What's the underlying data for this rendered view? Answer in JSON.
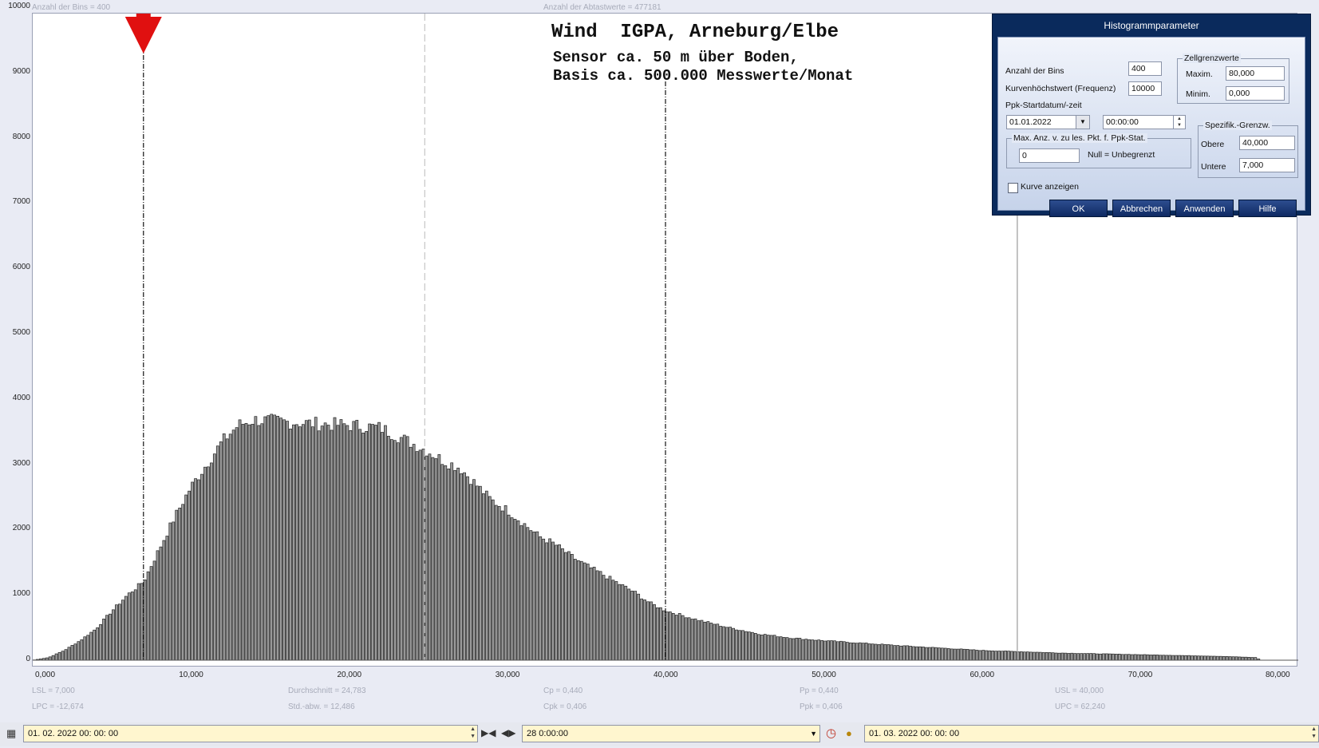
{
  "top_labels": {
    "bins": "Anzahl der Bins =   400",
    "samples": "Anzahl der Abtastwerte = 477181"
  },
  "title": {
    "line1": "Wind  IGPA, Arneburg/Elbe",
    "line2": "Sensor ca. 50 m über Boden,",
    "line3": "Basis ca. 500.000 Messwerte/Monat"
  },
  "stats": {
    "lsl": "LSL = 7,000",
    "lpc": "LPC = -12,674",
    "mean": "Durchschnitt  = 24,783",
    "std": "Std.-abw. = 12,486",
    "cp": "Cp  = 0,440",
    "cpk": "Cpk = 0,406",
    "pp": "Pp  = 0,440",
    "ppk": "Ppk = 0,406",
    "usl": "USL = 40,000",
    "upc": "UPC = 62,240"
  },
  "chart_data": {
    "type": "bar",
    "xlim": [
      0,
      80
    ],
    "ylim": [
      0,
      10000
    ],
    "x_ticks": [
      "0,000",
      "10,000",
      "20,000",
      "30,000",
      "40,000",
      "50,000",
      "60,000",
      "70,000",
      "80,000"
    ],
    "y_ticks": [
      "10000",
      "9000",
      "8000",
      "7000",
      "6000",
      "5000",
      "4000",
      "3000",
      "2000",
      "1000",
      "0"
    ],
    "bin_width": 0.2,
    "profile": [
      [
        0,
        0
      ],
      [
        1,
        40
      ],
      [
        2,
        150
      ],
      [
        3,
        300
      ],
      [
        4,
        480
      ],
      [
        5,
        750
      ],
      [
        6,
        1000
      ],
      [
        7,
        1200
      ],
      [
        8,
        1700
      ],
      [
        9,
        2200
      ],
      [
        10,
        2650
      ],
      [
        11,
        3000
      ],
      [
        12,
        3350
      ],
      [
        13,
        3600
      ],
      [
        14,
        3680
      ],
      [
        16,
        3650
      ],
      [
        18,
        3620
      ],
      [
        20,
        3600
      ],
      [
        22,
        3560
      ],
      [
        24,
        3320
      ],
      [
        25,
        3200
      ],
      [
        26,
        3050
      ],
      [
        27,
        2950
      ],
      [
        28,
        2700
      ],
      [
        29,
        2450
      ],
      [
        30,
        2300
      ],
      [
        31,
        2100
      ],
      [
        32,
        1900
      ],
      [
        33,
        1780
      ],
      [
        34,
        1600
      ],
      [
        35,
        1450
      ],
      [
        36,
        1320
      ],
      [
        37,
        1180
      ],
      [
        38,
        1050
      ],
      [
        39,
        880
      ],
      [
        40,
        760
      ],
      [
        42,
        620
      ],
      [
        44,
        500
      ],
      [
        46,
        400
      ],
      [
        48,
        340
      ],
      [
        50,
        300
      ],
      [
        55,
        220
      ],
      [
        60,
        150
      ],
      [
        65,
        110
      ],
      [
        70,
        85
      ],
      [
        75,
        60
      ],
      [
        77.4,
        40
      ],
      [
        77.6,
        0
      ],
      [
        80,
        0
      ]
    ],
    "lsl": 7,
    "usl": 40,
    "mean": 24.783,
    "upc": 62.24,
    "lsl_marker": "red-down-triangle"
  },
  "dialog": {
    "title": "Histogrammparameter",
    "bins_label": "Anzahl der Bins",
    "bins_value": "400",
    "peak_label": "Kurvenhöchstwert (Frequenz)",
    "peak_value": "10000",
    "ppk_start_label": "Ppk-Startdatum/-zeit",
    "date_value": "01.01.2022",
    "time_value": "00:00:00",
    "cell_group": "Zellgrenzwerte",
    "max_label": "Maxim.",
    "max_value": "80,000",
    "min_label": "Minim.",
    "min_value": "0,000",
    "maxpts_group": "Max. Anz. v. zu les. Pkt. f. Ppk-Stat.",
    "maxpts_value": "0",
    "null_hint": "Null = Unbegrenzt",
    "spec_group": "Spezifik.-Grenzw.",
    "upper_label": "Obere",
    "upper_value": "40,000",
    "lower_label": "Untere",
    "lower_value": "7,000",
    "curve_label": "Kurve anzeigen",
    "ok": "OK",
    "cancel": "Abbrechen",
    "apply": "Anwenden",
    "help": "Hilfe"
  },
  "bottom": {
    "start": "01. 02. 2022   00: 00: 00",
    "duration": "28  0:00:00",
    "end": "01. 03. 2022   00: 00: 00"
  }
}
